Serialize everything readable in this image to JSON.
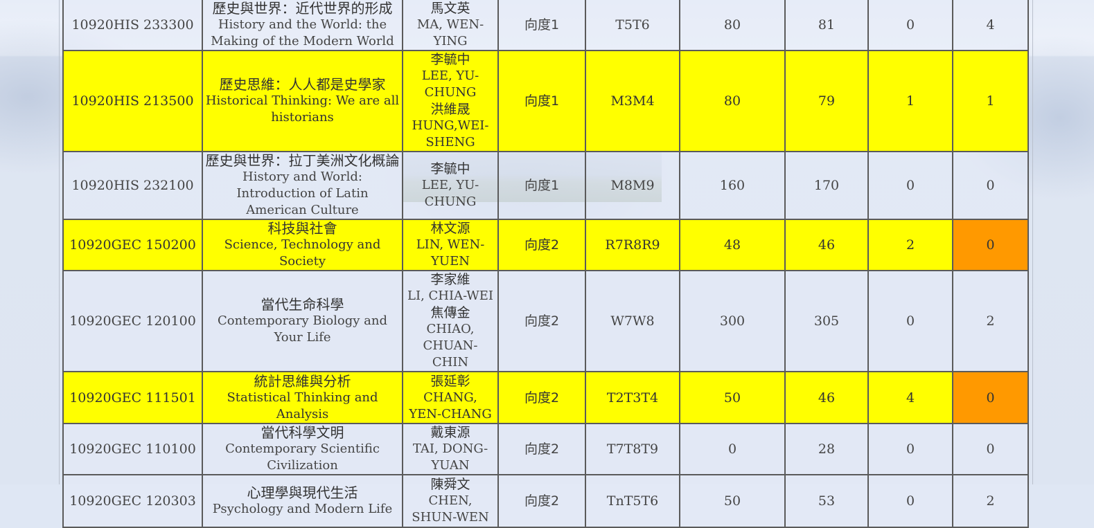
{
  "courses": [
    {
      "code": "10920HIS 233300",
      "title_zh": "歷史與世界：近代世界的形成",
      "title_en": "History and the World: the Making of the Modern World",
      "teachers": [
        {
          "zh": "馬文英",
          "en": "MA, WEN-YING"
        }
      ],
      "dimension": "向度1",
      "time": "T5T6",
      "limit": "80",
      "enrolled": "81",
      "remaining": "0",
      "waitlist": "4",
      "highlight": false,
      "waitlist_orange": false
    },
    {
      "code": "10920HIS 213500",
      "title_zh": "歷史思維：人人都是史學家",
      "title_en": "Historical Thinking: We are all historians",
      "teachers": [
        {
          "zh": "李毓中",
          "en": "LEE, YU-CHUNG"
        },
        {
          "zh": "洪維晟",
          "en": "HUNG,WEI-SHENG"
        }
      ],
      "dimension": "向度1",
      "time": "M3M4",
      "limit": "80",
      "enrolled": "79",
      "remaining": "1",
      "waitlist": "1",
      "highlight": true,
      "waitlist_orange": false
    },
    {
      "code": "10920HIS 232100",
      "title_zh": "歷史與世界：拉丁美洲文化概論",
      "title_en": "History and World: Introduction of Latin American Culture",
      "teachers": [
        {
          "zh": "李毓中",
          "en": "LEE, YU-CHUNG"
        }
      ],
      "dimension": "向度1",
      "time": "M8M9",
      "limit": "160",
      "enrolled": "170",
      "remaining": "0",
      "waitlist": "0",
      "highlight": false,
      "waitlist_orange": false
    },
    {
      "code": "10920GEC 150200",
      "title_zh": "科技與社會",
      "title_en": "Science, Technology and Society",
      "teachers": [
        {
          "zh": "林文源",
          "en": "LIN, WEN-YUEN"
        }
      ],
      "dimension": "向度2",
      "time": "R7R8R9",
      "limit": "48",
      "enrolled": "46",
      "remaining": "2",
      "waitlist": "0",
      "highlight": true,
      "waitlist_orange": true
    },
    {
      "code": "10920GEC 120100",
      "title_zh": "當代生命科學",
      "title_en": "Contemporary Biology and Your Life",
      "teachers": [
        {
          "zh": "李家維",
          "en": "LI, CHIA-WEI"
        },
        {
          "zh": "焦傳金",
          "en": "CHIAO, CHUAN-CHIN"
        }
      ],
      "dimension": "向度2",
      "time": "W7W8",
      "limit": "300",
      "enrolled": "305",
      "remaining": "0",
      "waitlist": "2",
      "highlight": false,
      "waitlist_orange": false
    },
    {
      "code": "10920GEC 111501",
      "title_zh": "統計思維與分析",
      "title_en": "Statistical Thinking and Analysis",
      "teachers": [
        {
          "zh": "張延彰",
          "en": "CHANG, YEN-CHANG"
        }
      ],
      "dimension": "向度2",
      "time": "T2T3T4",
      "limit": "50",
      "enrolled": "46",
      "remaining": "4",
      "waitlist": "0",
      "highlight": true,
      "waitlist_orange": true
    },
    {
      "code": "10920GEC 110100",
      "title_zh": "當代科學文明",
      "title_en": "Contemporary Scientific Civilization",
      "teachers": [
        {
          "zh": "戴東源",
          "en": "TAI, DONG-YUAN"
        }
      ],
      "dimension": "向度2",
      "time": "T7T8T9",
      "limit": "0",
      "enrolled": "28",
      "remaining": "0",
      "waitlist": "0",
      "highlight": false,
      "waitlist_orange": false
    },
    {
      "code": "10920GEC 120303",
      "title_zh": "心理學與現代生活",
      "title_en": "Psychology and Modern Life",
      "teachers": [
        {
          "zh": "陳舜文",
          "en": "CHEN, SHUN-WEN"
        }
      ],
      "dimension": "向度2",
      "time": "TnT5T6",
      "limit": "50",
      "enrolled": "53",
      "remaining": "0",
      "waitlist": "2",
      "highlight": false,
      "waitlist_orange": false
    }
  ]
}
